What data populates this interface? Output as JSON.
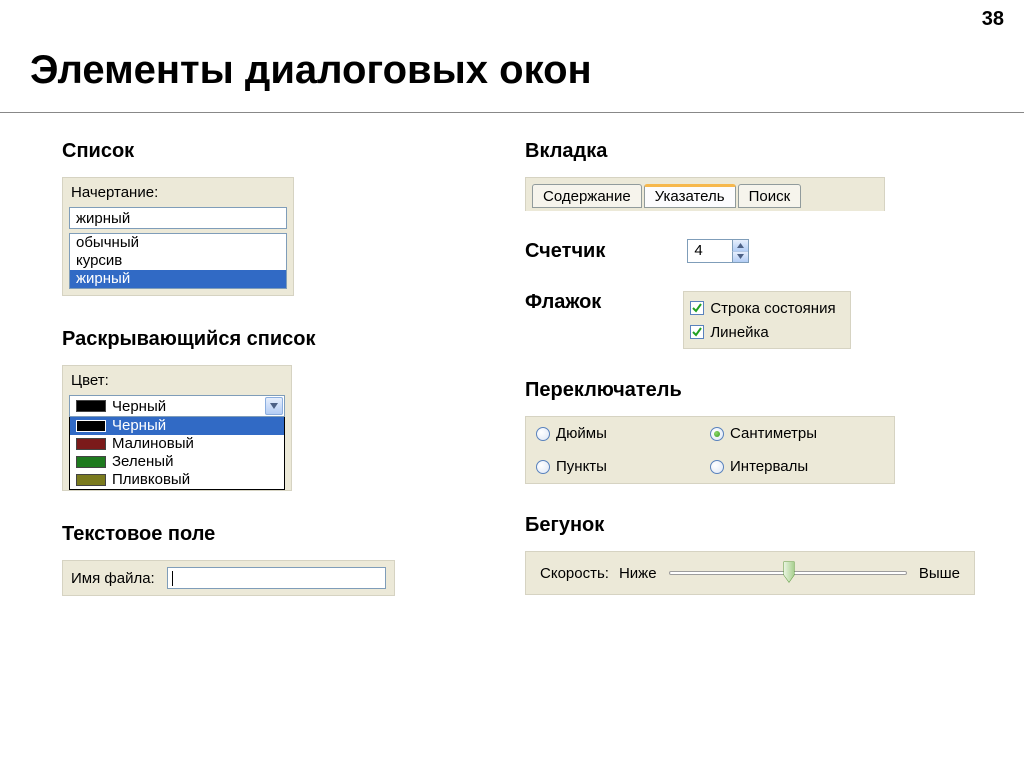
{
  "page_number": "38",
  "title": "Элементы диалоговых окон",
  "left": {
    "listbox": {
      "section": "Список",
      "caption": "Начертание:",
      "value": "жирный",
      "items": [
        "обычный",
        "курсив",
        "жирный"
      ],
      "selected_index": 2
    },
    "dropdown": {
      "section": "Раскрывающийся список",
      "caption": "Цвет:",
      "selected_label": "Черный",
      "items": [
        {
          "label": "Черный",
          "color": "#000000"
        },
        {
          "label": "Малиновый",
          "color": "#7b1a1a"
        },
        {
          "label": "Зеленый",
          "color": "#1e7a1e"
        },
        {
          "label": "Пливковый",
          "color": "#7a7a1e"
        }
      ],
      "selected_index": 0
    },
    "textbox": {
      "section": "Текстовое поле",
      "label": "Имя файла:",
      "value": ""
    }
  },
  "right": {
    "tabs": {
      "section": "Вкладка",
      "items": [
        "Содержание",
        "Указатель",
        "Поиск"
      ],
      "active_index": 1
    },
    "counter": {
      "section": "Счетчик",
      "value": "4"
    },
    "checkbox": {
      "section": "Флажок",
      "items": [
        {
          "label": "Строка состояния",
          "checked": true
        },
        {
          "label": "Линейка",
          "checked": true
        }
      ]
    },
    "radio": {
      "section": "Переключатель",
      "items": [
        {
          "label": "Дюймы",
          "checked": false
        },
        {
          "label": "Сантиметры",
          "checked": true
        },
        {
          "label": "Пункты",
          "checked": false
        },
        {
          "label": "Интервалы",
          "checked": false
        }
      ]
    },
    "slider": {
      "section": "Бегунок",
      "label": "Скорость:",
      "min_label": "Ниже",
      "max_label": "Выше"
    }
  }
}
